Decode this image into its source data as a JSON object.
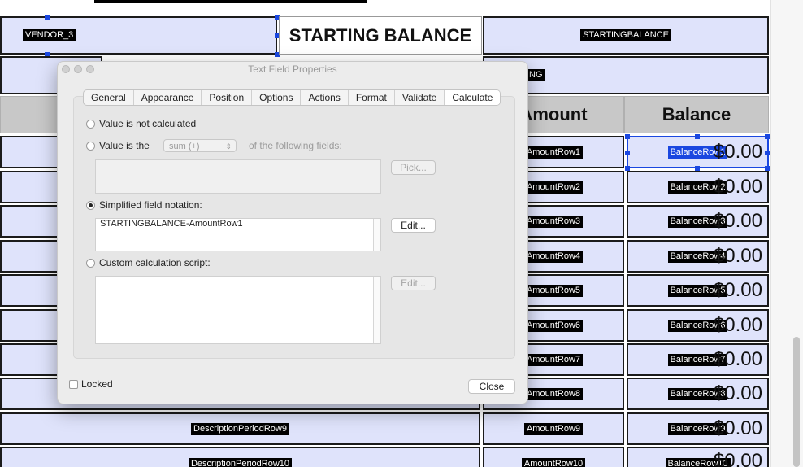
{
  "form": {
    "vendor_field": "VENDOR_3",
    "starting_balance_title": "STARTING BALANCE",
    "starting_balance_field": "STARTINGBALANCE",
    "partial_field": "NG",
    "amount_header": "Amount",
    "balance_header": "Balance",
    "money_value": "$0.00",
    "amount_rows": [
      "AmountRow1",
      "AmountRow2",
      "AmountRow3",
      "AmountRow4",
      "AmountRow5",
      "AmountRow6",
      "AmountRow7",
      "AmountRow8",
      "AmountRow9",
      "AmountRow10"
    ],
    "balance_rows": [
      "BalanceRow1",
      "BalanceRow2",
      "BalanceRow3",
      "BalanceRow4",
      "BalanceRow5",
      "BalanceRow6",
      "BalanceRow7",
      "BalanceRow8",
      "BalanceRow9",
      "BalanceRow10"
    ],
    "description_rows": {
      "row9": "DescriptionPeriodRow9",
      "row10": "DescriptionPeriodRow10"
    }
  },
  "dialog": {
    "title": "Text Field Properties",
    "tabs": [
      "General",
      "Appearance",
      "Position",
      "Options",
      "Actions",
      "Format",
      "Validate",
      "Calculate"
    ],
    "active_tab": "Calculate",
    "opt_not_calculated": "Value is not calculated",
    "opt_value_is_the": "Value is the",
    "function_select": "sum (+)",
    "of_following_fields": "of the following fields:",
    "pick_button": "Pick...",
    "opt_simplified": "Simplified field notation:",
    "simplified_value": "STARTINGBALANCE-AmountRow1",
    "edit_button": "Edit...",
    "opt_custom_script": "Custom calculation script:",
    "edit_button_disabled": "Edit...",
    "locked_label": "Locked",
    "close_button": "Close"
  },
  "colors": {
    "field_fill": "#dfe3fb",
    "selection": "#1a47e0",
    "header_fill": "#c8c8c8"
  }
}
